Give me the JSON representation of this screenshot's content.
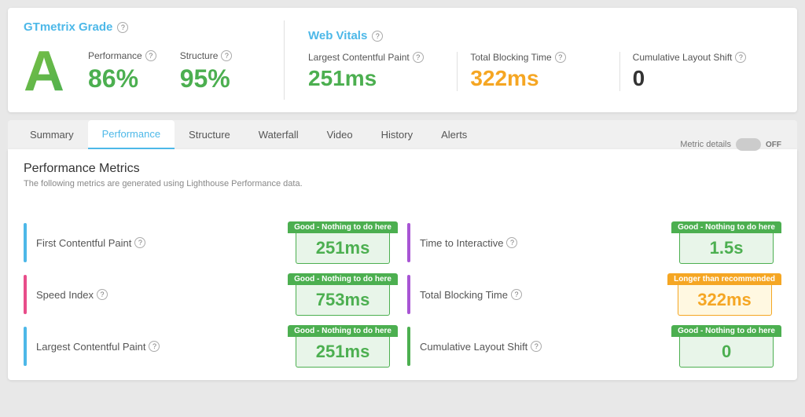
{
  "gtmetrix": {
    "title": "GTmetrix Grade",
    "info_icon": "?",
    "grade": "A",
    "performance_label": "Performance",
    "performance_value": "86%",
    "structure_label": "Structure",
    "structure_value": "95%"
  },
  "web_vitals": {
    "title": "Web Vitals",
    "info_icon": "?",
    "lcp_label": "Largest Contentful Paint",
    "lcp_info": "?",
    "lcp_value": "251ms",
    "tbt_label": "Total Blocking Time",
    "tbt_info": "?",
    "tbt_value": "322ms",
    "cls_label": "Cumulative Layout Shift",
    "cls_info": "?",
    "cls_value": "0"
  },
  "tabs": [
    {
      "id": "summary",
      "label": "Summary"
    },
    {
      "id": "performance",
      "label": "Performance"
    },
    {
      "id": "structure",
      "label": "Structure"
    },
    {
      "id": "waterfall",
      "label": "Waterfall"
    },
    {
      "id": "video",
      "label": "Video"
    },
    {
      "id": "history",
      "label": "History"
    },
    {
      "id": "alerts",
      "label": "Alerts"
    }
  ],
  "panel": {
    "title": "Performance Metrics",
    "subtitle": "The following metrics are generated using Lighthouse Performance data.",
    "metric_details_label": "Metric details",
    "toggle_state": "OFF"
  },
  "metrics": [
    {
      "name": "First Contentful Paint",
      "info": "?",
      "badge_label": "Good - Nothing to do here",
      "badge_type": "green",
      "value": "251ms",
      "bar_color": "blue"
    },
    {
      "name": "Time to Interactive",
      "info": "?",
      "badge_label": "Good - Nothing to do here",
      "badge_type": "green",
      "value": "1.5s",
      "bar_color": "purple"
    },
    {
      "name": "Speed Index",
      "info": "?",
      "badge_label": "Good - Nothing to do here",
      "badge_type": "green",
      "value": "753ms",
      "bar_color": "pink"
    },
    {
      "name": "Total Blocking Time",
      "info": "?",
      "badge_label": "Longer than recommended",
      "badge_type": "orange",
      "value": "322ms",
      "bar_color": "purple"
    },
    {
      "name": "Largest Contentful Paint",
      "info": "?",
      "badge_label": "Good - Nothing to do here",
      "badge_type": "green",
      "value": "251ms",
      "bar_color": "blue"
    },
    {
      "name": "Cumulative Layout Shift",
      "info": "?",
      "badge_label": "Good - Nothing to do here",
      "badge_type": "green",
      "value": "0",
      "bar_color": "green"
    }
  ]
}
